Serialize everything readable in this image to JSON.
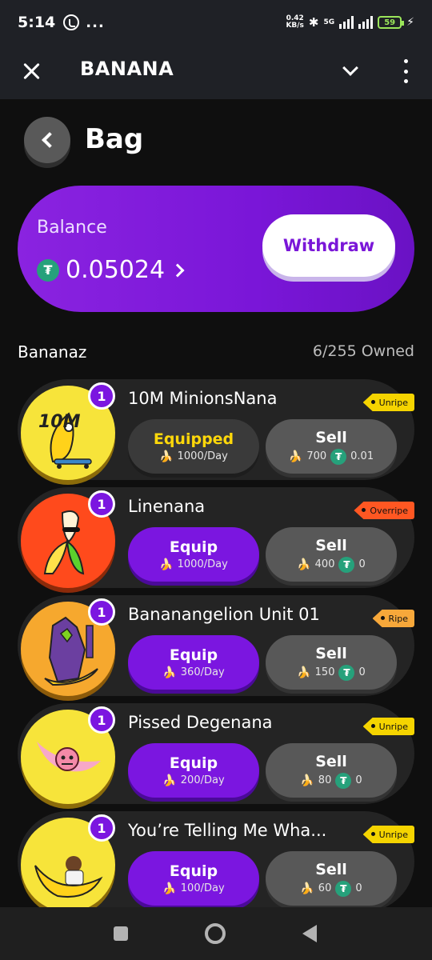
{
  "status_bar": {
    "time": "5:14",
    "more": "...",
    "speed_top": "0.42",
    "speed_unit": "KB/s",
    "network": "5G",
    "battery": "59"
  },
  "app_bar": {
    "title": "BANANA"
  },
  "page": {
    "title": "Bag"
  },
  "balance": {
    "label": "Balance",
    "amount": "0.05024",
    "withdraw_label": "Withdraw",
    "currency_icon": "tether-icon"
  },
  "section": {
    "title": "Bananaz",
    "count": "6/255 Owned"
  },
  "items": [
    {
      "qty": "1",
      "name": "10M MinionsNana",
      "tag": "Unripe",
      "tag_type": "unripe",
      "equip_label": "Equipped",
      "equipped": true,
      "rate": "1000/Day",
      "sell_label": "Sell",
      "sell_banana": "700",
      "sell_usdt": "0.01"
    },
    {
      "qty": "1",
      "name": "Linenana",
      "tag": "Overripe",
      "tag_type": "overripe",
      "equip_label": "Equip",
      "equipped": false,
      "rate": "1000/Day",
      "sell_label": "Sell",
      "sell_banana": "400",
      "sell_usdt": "0"
    },
    {
      "qty": "1",
      "name": "Bananangelion Unit 01",
      "tag": "Ripe",
      "tag_type": "ripe",
      "equip_label": "Equip",
      "equipped": false,
      "rate": "360/Day",
      "sell_label": "Sell",
      "sell_banana": "150",
      "sell_usdt": "0"
    },
    {
      "qty": "1",
      "name": "Pissed Degenana",
      "tag": "Unripe",
      "tag_type": "unripe",
      "equip_label": "Equip",
      "equipped": false,
      "rate": "200/Day",
      "sell_label": "Sell",
      "sell_banana": "80",
      "sell_usdt": "0"
    },
    {
      "qty": "1",
      "name": "You’re Telling Me Wha...",
      "tag": "Unripe",
      "tag_type": "unripe",
      "equip_label": "Equip",
      "equipped": false,
      "rate": "100/Day",
      "sell_label": "Sell",
      "sell_banana": "60",
      "sell_usdt": "0"
    }
  ],
  "thumb_labels": {
    "minions": "10M"
  },
  "colors": {
    "accent": "#7b16e0",
    "equipped_text": "#ffd80a",
    "unripe": "#f5d400",
    "overripe": "#ff5722",
    "ripe": "#f7a83a",
    "usdt": "#26a17b"
  }
}
